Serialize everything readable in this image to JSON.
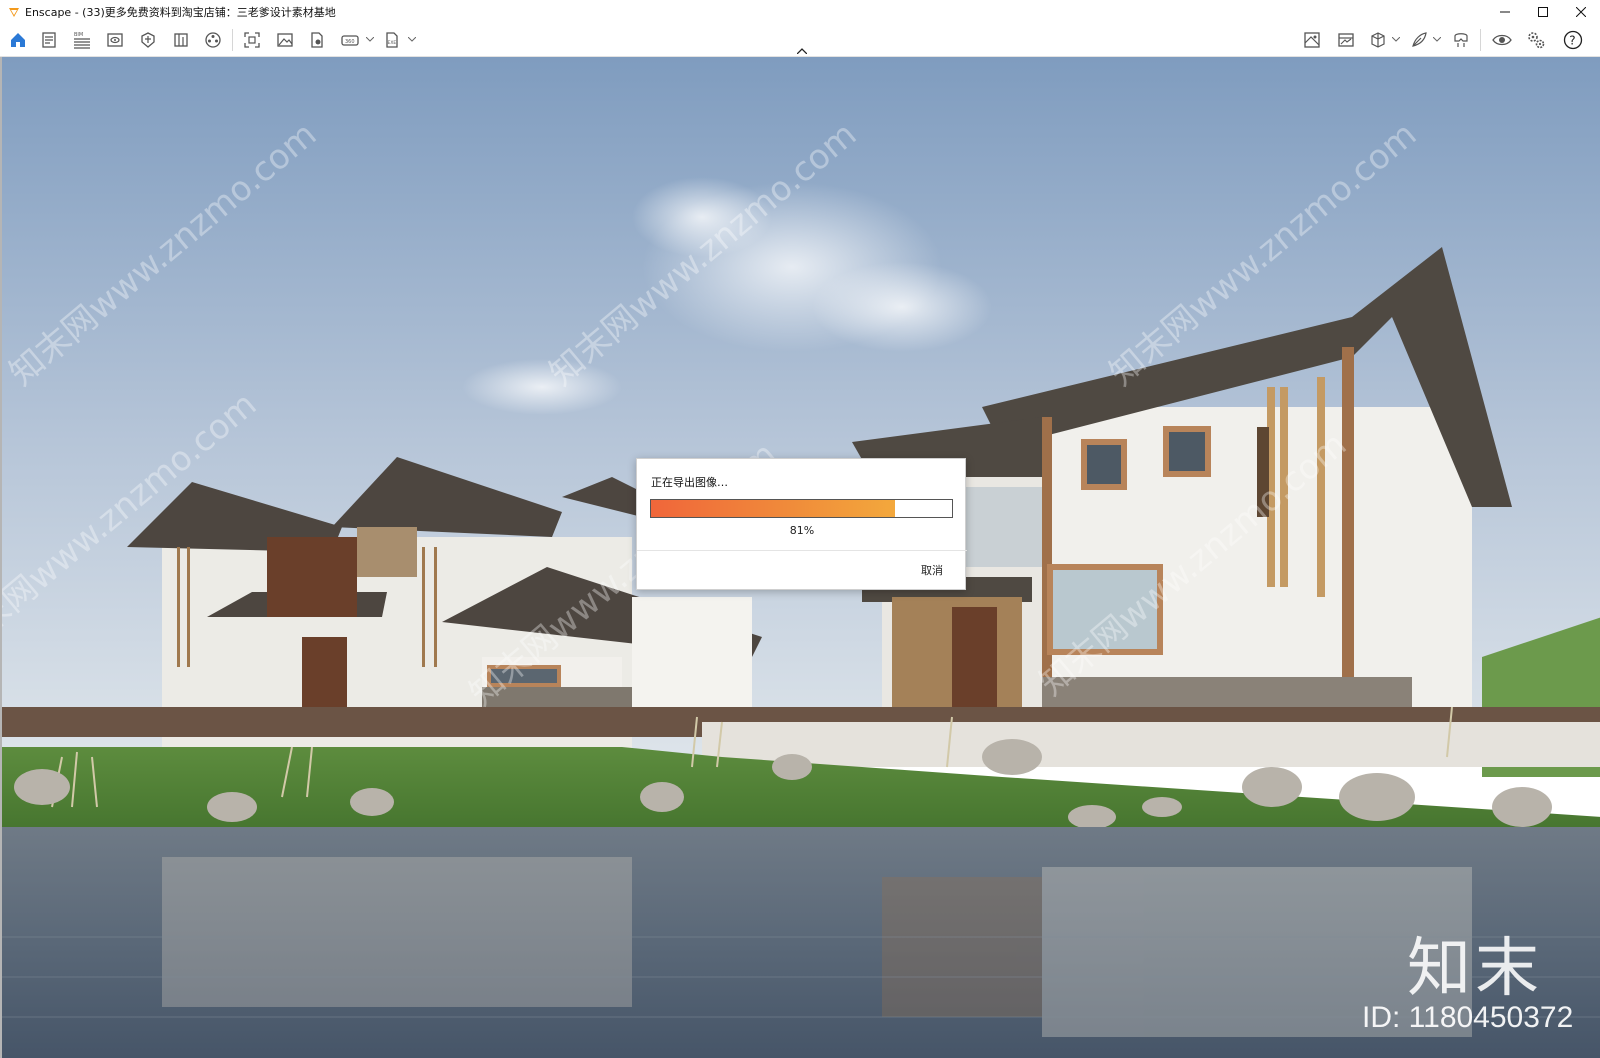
{
  "window": {
    "title": "Enscape - (33)更多免费资料到淘宝店铺：三老爹设计素材基地",
    "logo": "enscape-logo-icon",
    "controls": [
      "minimize-icon",
      "maximize-icon",
      "close-icon"
    ]
  },
  "toolbar": {
    "left_icons": [
      "home-icon",
      "document-icon",
      "bim-icon",
      "views-icon",
      "light-icon",
      "book-icon",
      "settings-wheel-icon",
      "screenshot-icon",
      "image-icon",
      "batch-render-icon",
      "panorama-icon",
      "export-exe-icon"
    ],
    "right_icons": [
      "map-icon",
      "gallery-icon",
      "cube-icon",
      "feather-icon",
      "vr-headset-icon",
      "eye-icon",
      "gears-icon",
      "help-icon"
    ],
    "accent_color": "#2b79d6"
  },
  "dialog": {
    "title": "正在导出图像…",
    "progress": 0.81,
    "progress_text": "81%",
    "cancel_label": "取消"
  },
  "watermark": {
    "diagonal_text": "知末网www.znzmo.com",
    "brand": "知末",
    "id_text": "ID: 1180450372"
  }
}
